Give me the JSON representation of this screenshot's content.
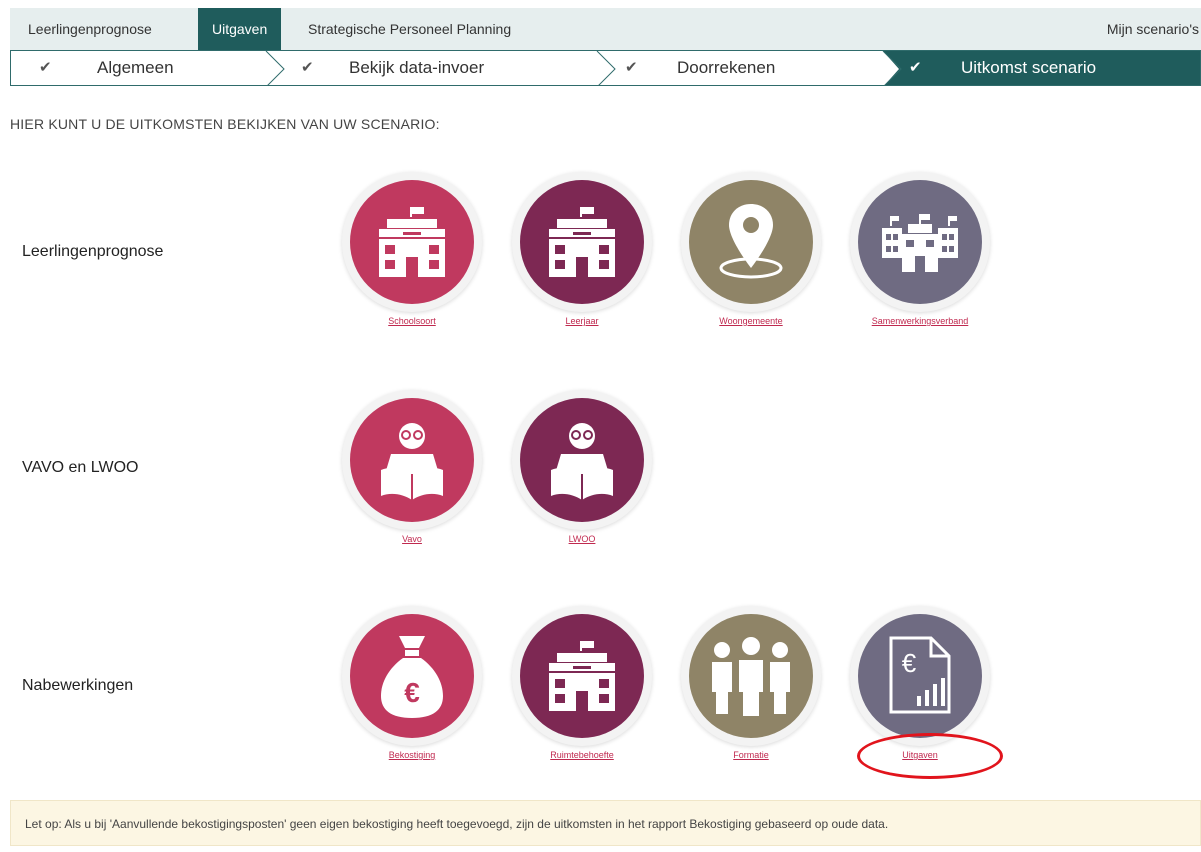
{
  "nav": {
    "tabs": [
      {
        "label": "Leerlingenprognose",
        "active": false
      },
      {
        "label": "Uitgaven",
        "active": true
      },
      {
        "label": "Strategische Personeel Planning",
        "active": false
      }
    ],
    "right_link": "Mijn scenario's"
  },
  "steps": [
    {
      "label": "Algemeen",
      "done": true
    },
    {
      "label": "Bekijk data-invoer",
      "done": true
    },
    {
      "label": "Doorrekenen",
      "done": true
    },
    {
      "label": "Uitkomst scenario",
      "active": true
    }
  ],
  "intro": "HIER KUNT U DE UITKOMSTEN BEKIJKEN VAN UW SCENARIO:",
  "sections": [
    {
      "label": "Leerlingenprognose",
      "tiles": [
        {
          "label": "Schoolsoort",
          "icon": "school-icon",
          "color": "#c0395f"
        },
        {
          "label": "Leerjaar",
          "icon": "school-icon",
          "color": "#7d2853"
        },
        {
          "label": "Woongemeente",
          "icon": "location-pin-icon",
          "color": "#8f8467"
        },
        {
          "label": "Samenwerkingsverband",
          "icon": "school-group-icon",
          "color": "#6f6b82"
        }
      ]
    },
    {
      "label": "VAVO en LWOO",
      "tiles": [
        {
          "label": "Vavo",
          "icon": "reader-icon",
          "color": "#c0395f"
        },
        {
          "label": "LWOO",
          "icon": "reader-icon",
          "color": "#7d2853"
        }
      ]
    },
    {
      "label": "Nabewerkingen",
      "tiles": [
        {
          "label": "Bekostiging",
          "icon": "money-bag-icon",
          "color": "#c0395f"
        },
        {
          "label": "Ruimtebehoefte",
          "icon": "school-icon",
          "color": "#7d2853"
        },
        {
          "label": "Formatie",
          "icon": "people-group-icon",
          "color": "#8f8467"
        },
        {
          "label": "Uitgaven",
          "icon": "expense-report-icon",
          "color": "#6f6b82"
        }
      ]
    }
  ],
  "notice": "Let op: Als u bij 'Aanvullende bekostigingsposten' geen eigen bekostiging heeft toegevoegd, zijn de uitkomsten in het rapport Bekostiging gebaseerd op oude data."
}
